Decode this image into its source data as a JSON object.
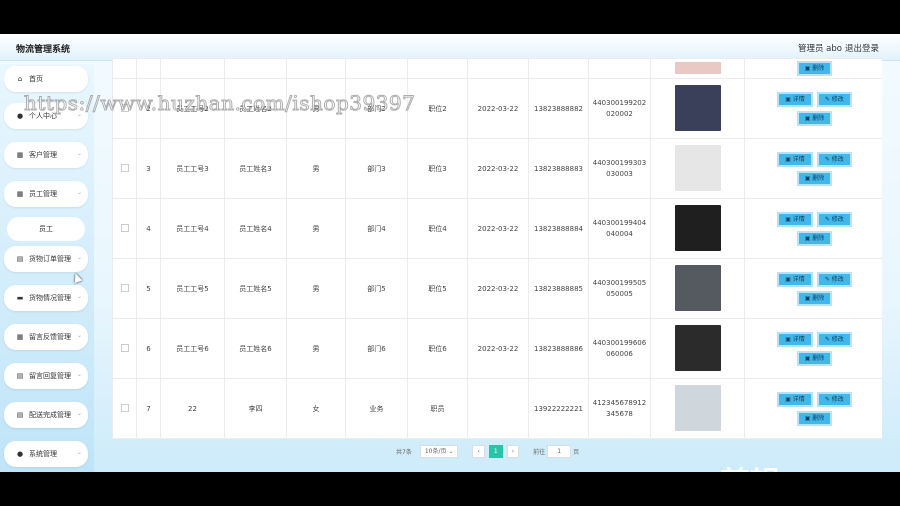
{
  "header": {
    "title": "物流管理系统",
    "admin": "管理员 abo",
    "logout": "退出登录"
  },
  "sidebar": {
    "items": [
      {
        "label": "首页",
        "icon": "home-icon",
        "glyph": "⌂",
        "chevron": false
      },
      {
        "label": "个人中心",
        "icon": "user-icon",
        "glyph": "●",
        "chevron": true
      },
      {
        "label": "客户管理",
        "icon": "grid-icon",
        "glyph": "▦",
        "chevron": true
      },
      {
        "label": "员工管理",
        "icon": "grid-icon",
        "glyph": "▦",
        "chevron": true
      },
      {
        "label": "货物订单管理",
        "icon": "list-icon",
        "glyph": "▤",
        "chevron": true
      },
      {
        "label": "货物情况管理",
        "icon": "box-icon",
        "glyph": "▬",
        "chevron": true
      },
      {
        "label": "留言反馈管理",
        "icon": "grid-icon",
        "glyph": "▦",
        "chevron": true
      },
      {
        "label": "留言回复管理",
        "icon": "doc-icon",
        "glyph": "▤",
        "chevron": true
      },
      {
        "label": "配送完成管理",
        "icon": "doc-icon",
        "glyph": "▤",
        "chevron": true
      },
      {
        "label": "系统管理",
        "icon": "user-icon",
        "glyph": "●",
        "chevron": true
      }
    ],
    "sub_item": "员工"
  },
  "table": {
    "partial_delete": "删除",
    "rows": [
      {
        "idx": "2",
        "no": "员工工号2",
        "name": "员工姓名2",
        "sex": "男",
        "dept": "部门2",
        "pos": "职位2",
        "date": "2022-03-22",
        "phone": "13823888882",
        "idcard": "440300199202020002",
        "photo_color": "#3a3f5a"
      },
      {
        "idx": "3",
        "no": "员工工号3",
        "name": "员工姓名3",
        "sex": "男",
        "dept": "部门3",
        "pos": "职位3",
        "date": "2022-03-22",
        "phone": "13823888883",
        "idcard": "440300199303030003",
        "photo_color": "#e6e6e6"
      },
      {
        "idx": "4",
        "no": "员工工号4",
        "name": "员工姓名4",
        "sex": "男",
        "dept": "部门4",
        "pos": "职位4",
        "date": "2022-03-22",
        "phone": "13823888884",
        "idcard": "440300199404040004",
        "photo_color": "#1f1f1f"
      },
      {
        "idx": "5",
        "no": "员工工号5",
        "name": "员工姓名5",
        "sex": "男",
        "dept": "部门5",
        "pos": "职位5",
        "date": "2022-03-22",
        "phone": "13823888885",
        "idcard": "440300199505050005",
        "photo_color": "#555a60"
      },
      {
        "idx": "6",
        "no": "员工工号6",
        "name": "员工姓名6",
        "sex": "男",
        "dept": "部门6",
        "pos": "职位6",
        "date": "2022-03-22",
        "phone": "13823888886",
        "idcard": "440300199606060006",
        "photo_color": "#2b2b2b"
      },
      {
        "idx": "7",
        "no": "22",
        "name": "李四",
        "sex": "女",
        "dept": "业务",
        "pos": "职员",
        "date": "",
        "phone": "13922222221",
        "idcard": "412345678912345678",
        "photo_color": "#cfd6dc"
      }
    ],
    "btn_detail": "详情",
    "btn_edit": "修改",
    "btn_delete": "删除"
  },
  "pagination": {
    "total": "共7条",
    "page_size": "10条/页",
    "prev": "‹",
    "current": "1",
    "next": "›",
    "goto": "前往",
    "goto_value": "1",
    "page_unit": "页"
  },
  "overlay": {
    "watermark": "https://www.huzhan.com/ishop39397",
    "ev_mark": "ev剪辑"
  }
}
